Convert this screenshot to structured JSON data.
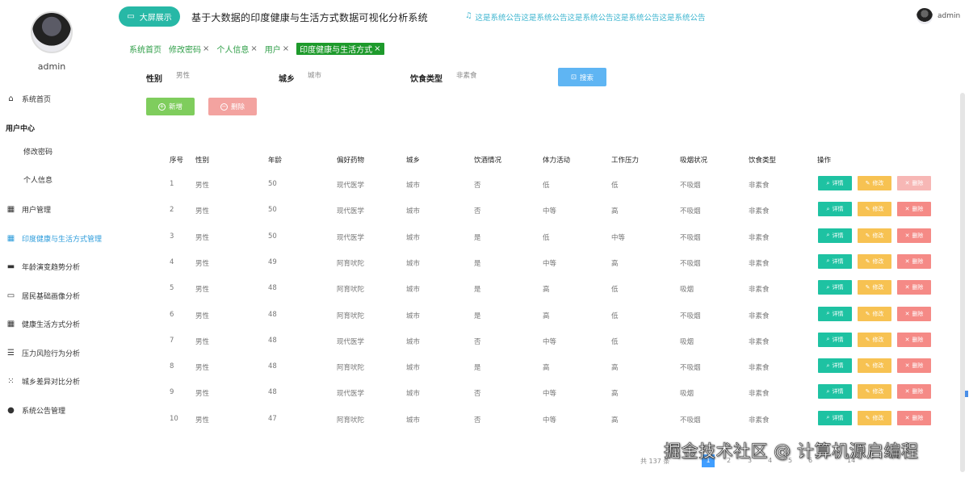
{
  "sidebar": {
    "username": "admin",
    "home": "系统首页",
    "group": "用户中心",
    "sub_items": [
      "修改密码",
      "个人信息"
    ],
    "items": [
      {
        "label": "用户管理",
        "icon": "grid-icon"
      },
      {
        "label": "印度健康与生活方式管理",
        "icon": "grid-icon"
      },
      {
        "label": "年龄演变趋势分析",
        "icon": "chat-icon"
      },
      {
        "label": "居民基础画像分析",
        "icon": "briefcase-icon"
      },
      {
        "label": "健康生活方式分析",
        "icon": "grid-icon"
      },
      {
        "label": "压力风险行为分析",
        "icon": "list-icon"
      },
      {
        "label": "城乡差异对比分析",
        "icon": "apps-icon"
      },
      {
        "label": "系统公告管理",
        "icon": "pin-icon"
      }
    ]
  },
  "header": {
    "big_screen": "大屏展示",
    "title": "基于大数据的印度健康与生活方式数据可视化分析系统",
    "notice": "这是系统公告这是系统公告这是系统公告这是系统公告这是系统公告",
    "user": "admin"
  },
  "tabs": [
    {
      "label": "系统首页",
      "close": ""
    },
    {
      "label": "修改密码",
      "close": "×"
    },
    {
      "label": "个人信息",
      "close": "×"
    },
    {
      "label": "用户",
      "close": "×"
    },
    {
      "label": "印度健康与生活方式",
      "close": "×"
    }
  ],
  "search": {
    "gender_label": "性别",
    "gender_placeholder": "男性",
    "region_label": "城乡",
    "region_placeholder": "城市",
    "diet_label": "饮食类型",
    "diet_placeholder": "非素食",
    "search_button": "搜索"
  },
  "actions": {
    "add": "新增",
    "delete": "删除"
  },
  "table": {
    "headers": [
      "序号",
      "性别",
      "年龄",
      "偏好药物",
      "城乡",
      "饮酒情况",
      "体力活动",
      "工作压力",
      "吸烟状况",
      "饮食类型",
      "操作"
    ],
    "row_actions": {
      "detail": "详情",
      "edit": "修改",
      "delete": "删除"
    },
    "rows": [
      [
        "1",
        "男性",
        "50",
        "现代医学",
        "城市",
        "否",
        "低",
        "低",
        "不吸烟",
        "非素食"
      ],
      [
        "2",
        "男性",
        "50",
        "现代医学",
        "城市",
        "否",
        "中等",
        "高",
        "不吸烟",
        "非素食"
      ],
      [
        "3",
        "男性",
        "50",
        "现代医学",
        "城市",
        "是",
        "低",
        "中等",
        "不吸烟",
        "非素食"
      ],
      [
        "4",
        "男性",
        "49",
        "阿育吠陀",
        "城市",
        "是",
        "中等",
        "高",
        "不吸烟",
        "非素食"
      ],
      [
        "5",
        "男性",
        "48",
        "阿育吠陀",
        "城市",
        "是",
        "高",
        "低",
        "吸烟",
        "非素食"
      ],
      [
        "6",
        "男性",
        "48",
        "阿育吠陀",
        "城市",
        "是",
        "高",
        "低",
        "不吸烟",
        "非素食"
      ],
      [
        "7",
        "男性",
        "48",
        "现代医学",
        "城市",
        "否",
        "中等",
        "低",
        "吸烟",
        "非素食"
      ],
      [
        "8",
        "男性",
        "48",
        "阿育吠陀",
        "城市",
        "是",
        "高",
        "高",
        "不吸烟",
        "非素食"
      ],
      [
        "9",
        "男性",
        "48",
        "现代医学",
        "城市",
        "否",
        "中等",
        "高",
        "吸烟",
        "非素食"
      ],
      [
        "10",
        "男性",
        "47",
        "阿育吠陀",
        "城市",
        "否",
        "中等",
        "高",
        "不吸烟",
        "非素食"
      ]
    ]
  },
  "pagination": {
    "total": "共 137 条",
    "current": "1",
    "pages": [
      "2",
      "3",
      "4",
      "5",
      "6",
      "14"
    ]
  },
  "watermark": "掘金技术社区 @ 计算机源启编程"
}
